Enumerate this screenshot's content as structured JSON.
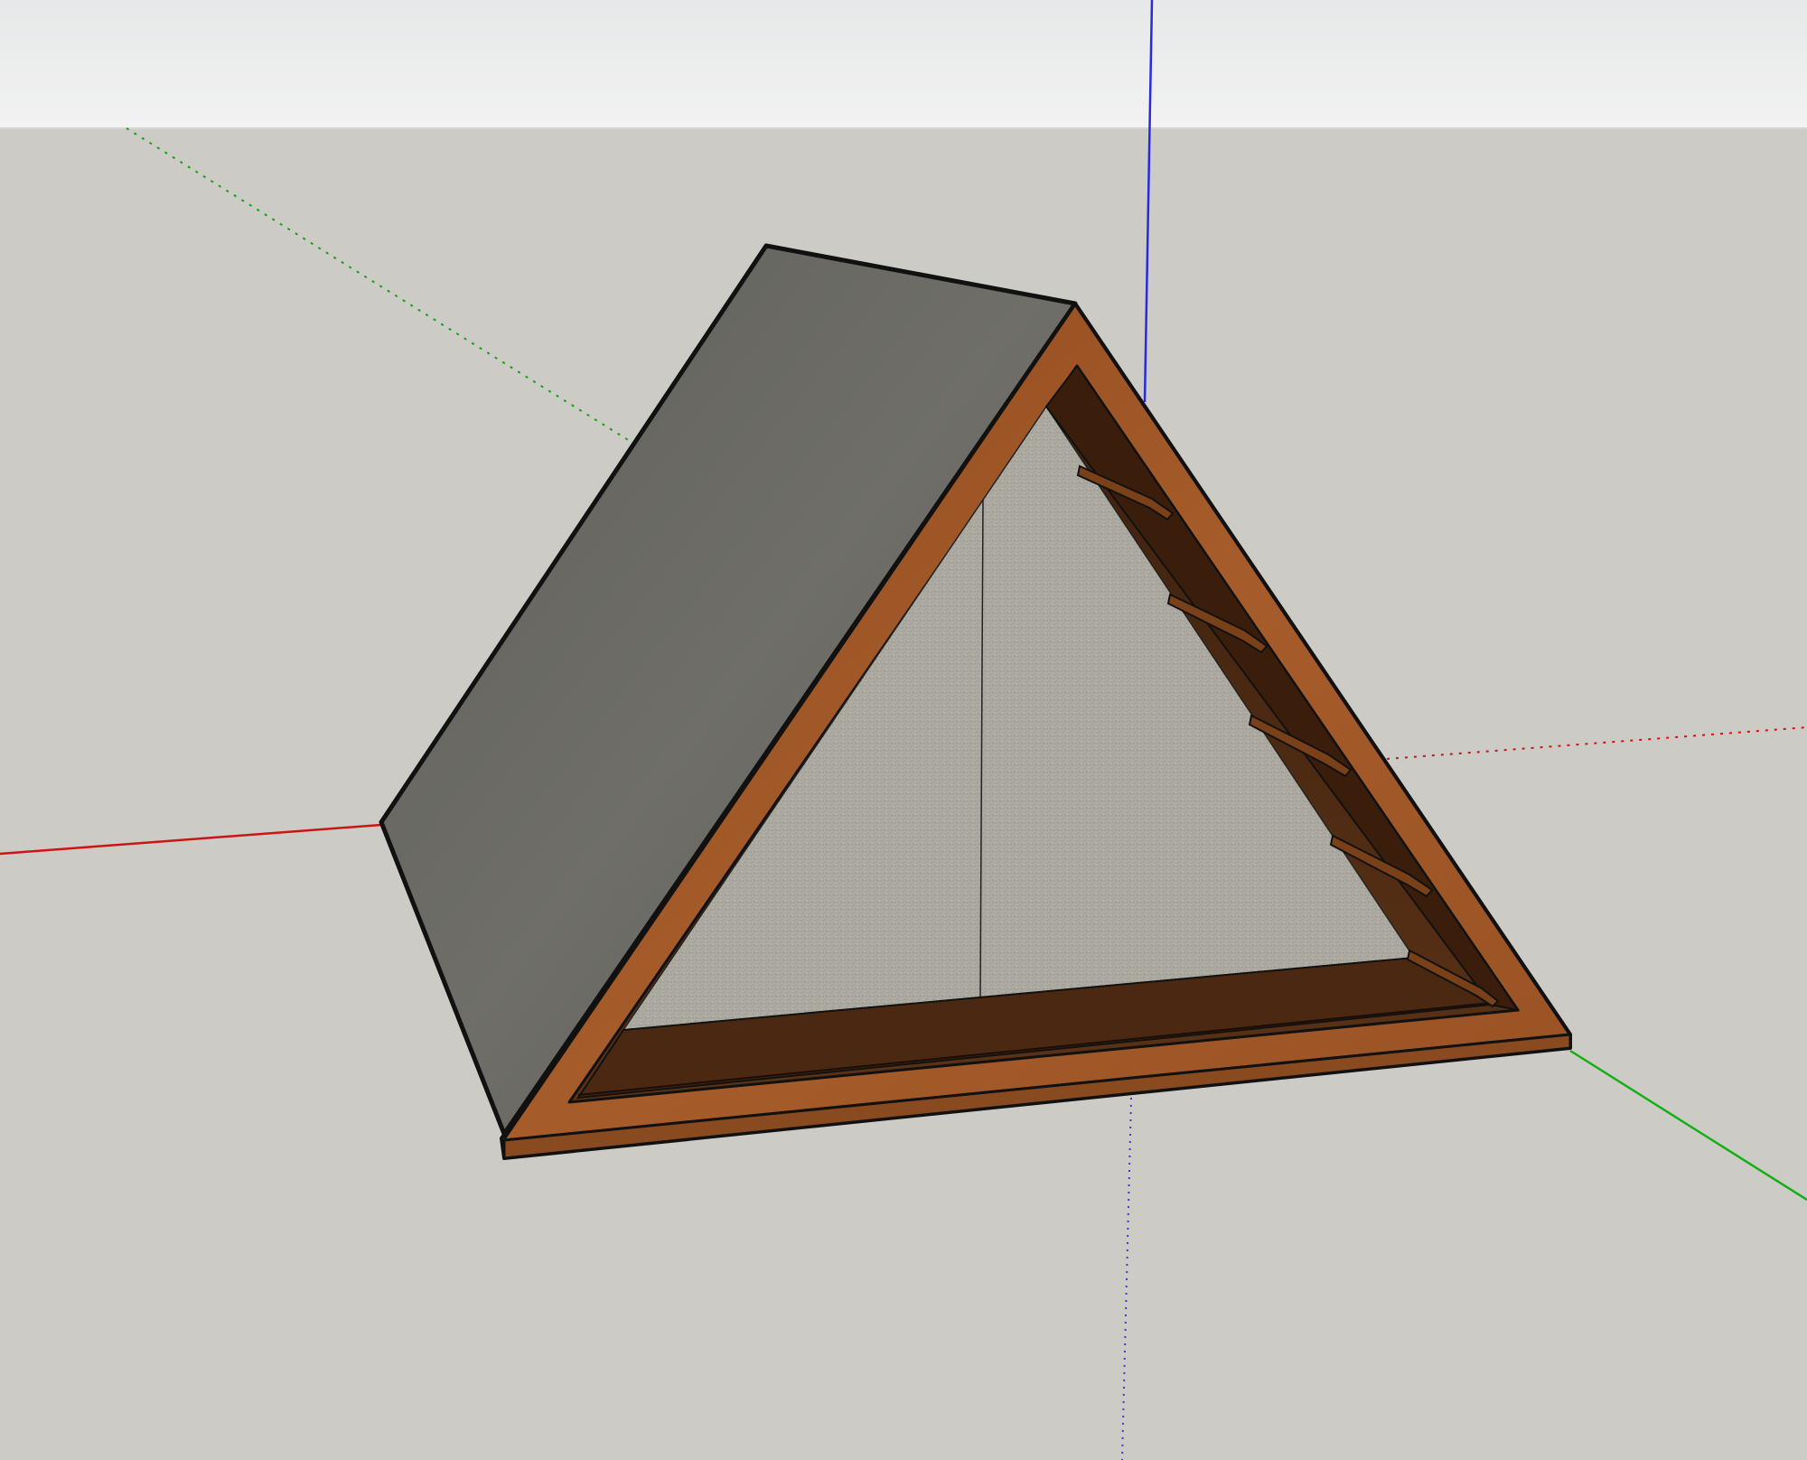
{
  "app": {
    "name": "",
    "view": "perspective"
  },
  "colors": {
    "sky_top": "#e6e8e9",
    "sky_bottom": "#f1f1f1",
    "ground": "#cccbc6",
    "axis_red": "#d01818",
    "axis_green": "#10b010",
    "axis_blue": "#2020d8",
    "roof_gray": "#6e6e68",
    "wood_front": "#9c5426",
    "wood_inner": "#4d2a12",
    "back_wall": "#a8a59c",
    "edge": "#111111"
  },
  "model": {
    "name": "",
    "shelf_count": 4,
    "materials": [
      "gray-roof",
      "wood-frame",
      "speckled-back-panel"
    ]
  },
  "axes": {
    "red_axis": "red",
    "green_axis": "green",
    "blue_axis": "blue"
  }
}
